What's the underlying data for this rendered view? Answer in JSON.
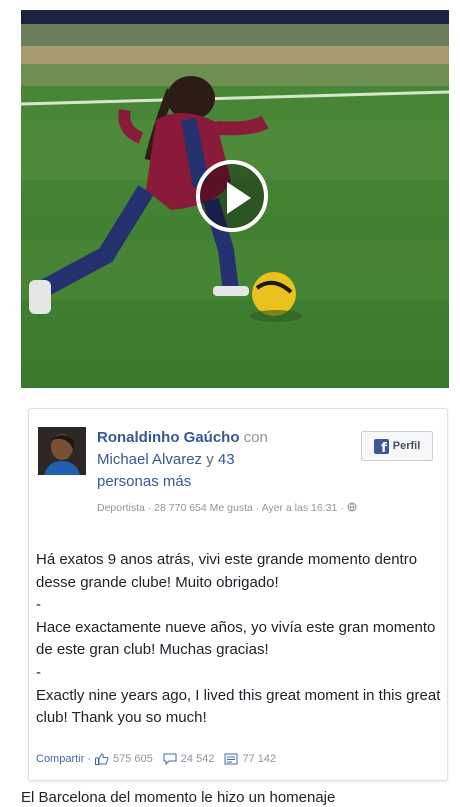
{
  "video": {
    "play_icon": "play-icon"
  },
  "post": {
    "author": "Ronaldinho Gaúcho",
    "con_word": "con",
    "tagged": "Michael Alvarez",
    "y_word": "y",
    "others_count": "43",
    "others_word": "personas más",
    "meta": "Deportista · 28 770 654 Me gusta · Ayer a las 16:31 ·",
    "perfil_label": "Perfil",
    "text_lines": [
      "Há exatos 9 anos atrás, vivi este grande momento dentro desse grande clube! Muito obrigado!",
      "-",
      "Hace exactamente nueve años, yo vivía este gran momento de este gran club! Muchas gracias!",
      "-",
      "Exactly nine years ago, I lived this great moment in this great club! Thank you so much!"
    ],
    "share_label": "Compartir ·",
    "likes": "575 605",
    "comments": "24 542",
    "shares": "77 142"
  },
  "bottom_caption": "El  Barcelona del momento le  hizo un homenaje",
  "colors": {
    "link": "#365899",
    "meta": "#90949c",
    "facebook_blue": "#3b5998"
  }
}
